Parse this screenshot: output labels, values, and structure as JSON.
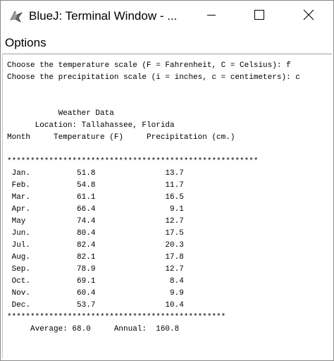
{
  "window": {
    "title": "BlueJ: Terminal Window - ...",
    "app_icon": "bluej-bird-icon",
    "controls": {
      "minimize_icon": "minimize-icon",
      "maximize_icon": "maximize-icon",
      "close_icon": "close-icon"
    }
  },
  "menubar": {
    "options_label": "Options"
  },
  "terminal": {
    "lines": [
      "Choose the temperature scale (F = Fahrenheit, C = Celsius): f",
      "Choose the precipitation scale (i = inches, c = centimeters): c",
      "",
      "",
      "           Weather Data",
      "      Location: Tallahassee, Florida",
      "Month     Temperature (F)     Precipitation (cm.)",
      "",
      "******************************************************",
      " Jan.          51.8               13.7",
      " Feb.          54.8               11.7",
      " Mar.          61.1               16.5",
      " Apr.          66.4                9.1",
      " May           74.4               12.7",
      " Jun.          80.4               17.5",
      " Jul.          82.4               20.3",
      " Aug.          82.1               17.8",
      " Sep.          78.9               12.7",
      " Oct.          69.1                8.4",
      " Nov.          60.4                9.9",
      " Dec.          53.7               10.4",
      "***********************************************",
      "     Average: 68.0     Annual:  160.8"
    ]
  }
}
